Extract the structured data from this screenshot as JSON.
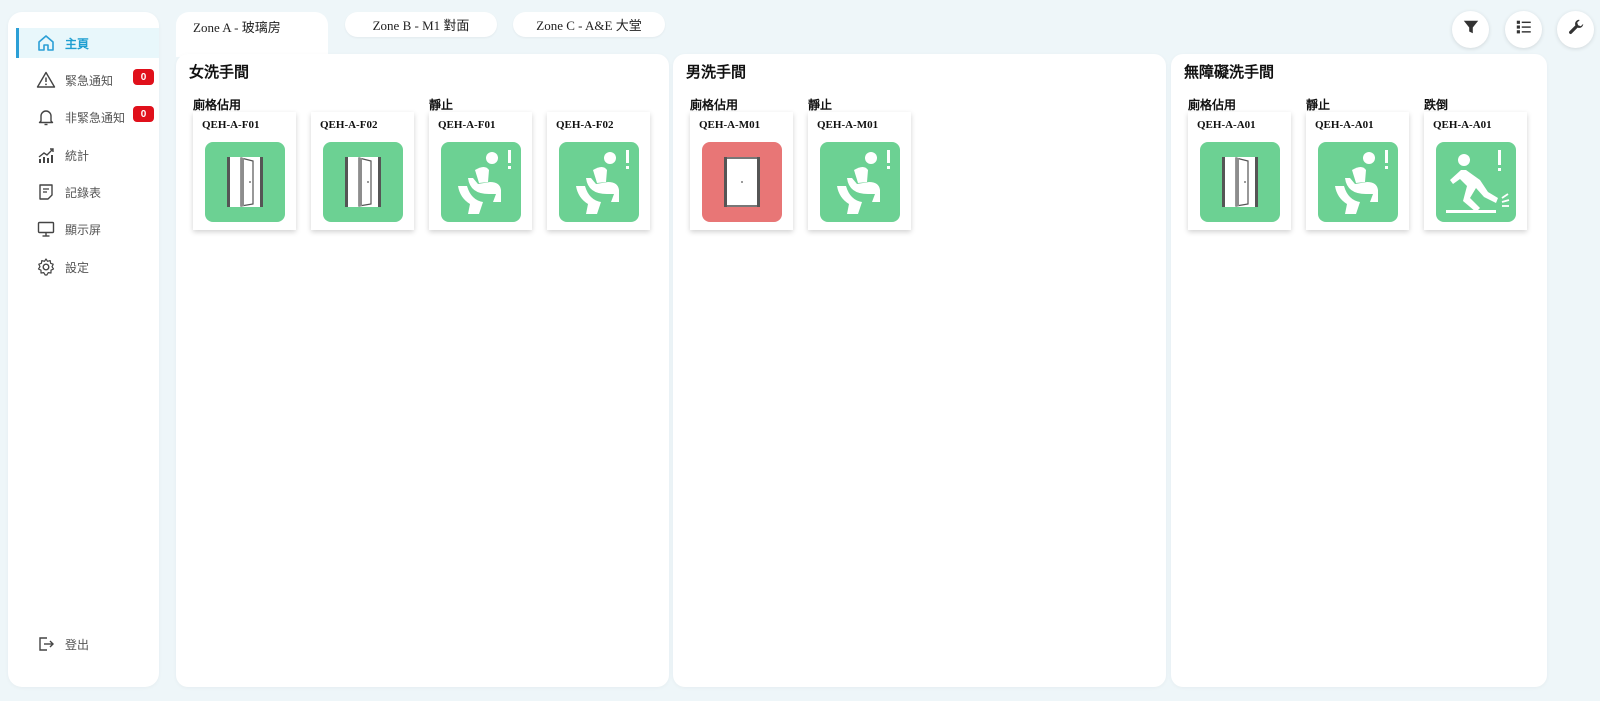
{
  "sidebar": {
    "items": [
      {
        "label": "主頁",
        "icon": "home-icon",
        "active": true
      },
      {
        "label": "緊急通知",
        "icon": "warning-icon",
        "badge": "0"
      },
      {
        "label": "非緊急通知",
        "icon": "bell-icon",
        "badge": "0"
      },
      {
        "label": "統計",
        "icon": "chart-icon"
      },
      {
        "label": "記錄表",
        "icon": "document-icon"
      },
      {
        "label": "顯示屏",
        "icon": "monitor-icon"
      },
      {
        "label": "設定",
        "icon": "gear-icon"
      }
    ],
    "logout": {
      "label": "登出",
      "icon": "logout-icon"
    }
  },
  "tabs": [
    {
      "label": "Zone A - 玻璃房",
      "active": true
    },
    {
      "label": "Zone B - M1 對面",
      "active": false
    },
    {
      "label": "Zone C - A&E 大堂",
      "active": false
    }
  ],
  "toolbar": [
    "filter-icon",
    "list-icon",
    "wrench-icon"
  ],
  "colors": {
    "accent": "#2b9fd6",
    "ok": "#6cd193",
    "occupied": "#e87676",
    "badge": "#e0101b"
  },
  "panels": [
    {
      "title": "女洗手間",
      "groups": [
        {
          "label": "廁格佔用",
          "cards": [
            {
              "id": "QEH-A-F01",
              "icon": "door-open-icon",
              "status": "ok"
            },
            {
              "id": "QEH-A-F02",
              "icon": "door-open-icon",
              "status": "ok"
            }
          ]
        },
        {
          "label": "靜止",
          "cards": [
            {
              "id": "QEH-A-F01",
              "icon": "toilet-person-icon",
              "status": "ok"
            },
            {
              "id": "QEH-A-F02",
              "icon": "toilet-person-icon",
              "status": "ok"
            }
          ]
        }
      ]
    },
    {
      "title": "男洗手間",
      "groups": [
        {
          "label": "廁格佔用",
          "cards": [
            {
              "id": "QEH-A-M01",
              "icon": "door-closed-icon",
              "status": "occupied"
            }
          ]
        },
        {
          "label": "靜止",
          "cards": [
            {
              "id": "QEH-A-M01",
              "icon": "toilet-person-icon",
              "status": "ok"
            }
          ]
        }
      ]
    },
    {
      "title": "無障礙洗手間",
      "groups": [
        {
          "label": "廁格佔用",
          "cards": [
            {
              "id": "QEH-A-A01",
              "icon": "door-open-icon",
              "status": "ok"
            }
          ]
        },
        {
          "label": "靜止",
          "cards": [
            {
              "id": "QEH-A-A01",
              "icon": "toilet-person-icon",
              "status": "ok"
            }
          ]
        },
        {
          "label": "跌倒",
          "cards": [
            {
              "id": "QEH-A-A01",
              "icon": "fall-icon",
              "status": "ok"
            }
          ]
        }
      ]
    }
  ]
}
